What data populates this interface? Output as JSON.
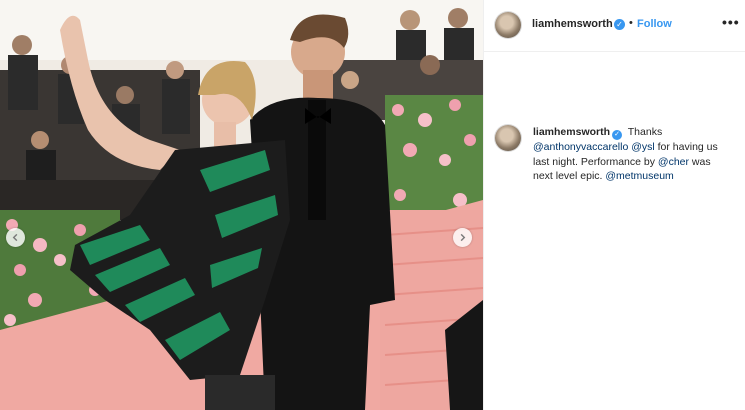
{
  "post": {
    "username": "liamhemsworth",
    "verified_icon": "verified-badge-icon",
    "separator": "•",
    "follow_label": "Follow",
    "more_label": "•••"
  },
  "caption": {
    "username": "liamhemsworth",
    "parts": [
      {
        "type": "text",
        "text": "Thanks "
      },
      {
        "type": "mention",
        "text": "@anthonyvaccarello"
      },
      {
        "type": "text",
        "text": " "
      },
      {
        "type": "mention",
        "text": "@ysl"
      },
      {
        "type": "text",
        "text": " for having us last night. Performance by "
      },
      {
        "type": "mention",
        "text": "@cher"
      },
      {
        "type": "text",
        "text": " was next level epic. "
      },
      {
        "type": "mention",
        "text": "@metmuseum"
      }
    ]
  },
  "carousel": {
    "prev_icon": "chevron-left-icon",
    "next_icon": "chevron-right-icon"
  },
  "colors": {
    "link": "#003569",
    "accent": "#3897f0",
    "text": "#262626"
  }
}
